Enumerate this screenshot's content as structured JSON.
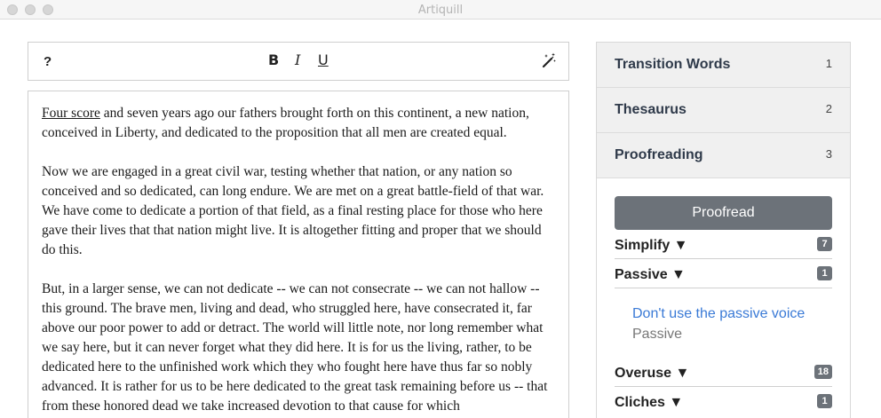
{
  "window": {
    "title": "Artiquill"
  },
  "toolbar": {
    "help": "?",
    "bold": "B",
    "italic": "I",
    "underline": "U",
    "magic_icon": "magic-wand-icon"
  },
  "editor": {
    "p1_underlined": "Four score",
    "p1_rest": " and seven years ago our fathers brought forth on this continent, a new nation, conceived in Liberty, and dedicated to the proposition that all men are created equal.",
    "p2": "Now we are engaged in a great civil war, testing whether that nation, or any nation so conceived and so dedicated, can long endure. We are met on a great battle-field of that war. We have come to dedicate a portion of that field, as a final resting place for those who here gave their lives that that nation might live. It is altogether fitting and proper that we should do this.",
    "p3": "But, in a larger sense, we can not dedicate -- we can not consecrate -- we can not hallow -- this ground. The brave men, living and dead, who struggled here, have consecrated it, far above our poor power to add or detract. The world will little note, nor long remember what we say here, but it can never forget what they did here. It is for us the living, rather, to be dedicated here to the unfinished work which they who fought here have thus far so nobly advanced. It is rather for us to be here dedicated to the great task remaining before us -- that from these honored dead we take increased devotion to that cause for which"
  },
  "panel": {
    "sections": [
      {
        "title": "Transition Words",
        "num": "1"
      },
      {
        "title": "Thesaurus",
        "num": "2"
      },
      {
        "title": "Proofreading",
        "num": "3"
      }
    ],
    "proofread_button": "Proofread",
    "categories": {
      "simplify": {
        "label": "Simplify ▼",
        "count": "7"
      },
      "passive": {
        "label": "Passive ▼",
        "count": "1"
      },
      "overuse": {
        "label": "Overuse ▼",
        "count": "18"
      },
      "cliches": {
        "label": "Cliches ▼",
        "count": "1"
      }
    },
    "passive_issue": {
      "link": "Don't use the passive voice",
      "type": "Passive"
    }
  }
}
